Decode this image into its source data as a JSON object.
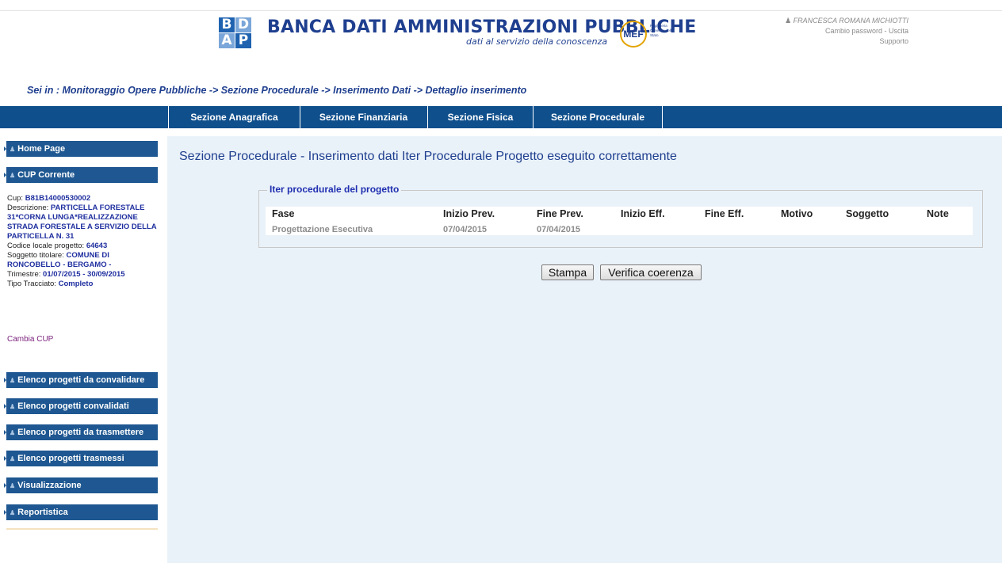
{
  "header": {
    "logo_letters": [
      "B",
      "D",
      "A",
      "P"
    ],
    "title": "BANCA DATI AMMINISTRAZIONI PUBBLICHE",
    "subtitle": "dati al servizio della conoscenza",
    "mef_logo": "MEF",
    "mef_text": "Ragioneria Generale dello Stato",
    "user_icon": "user-icon",
    "user_name": "FRANCESCA ROMANA MICHIOTTI",
    "change_password": "Cambio password",
    "separator": " - ",
    "logout": "Uscita",
    "support": "Supporto"
  },
  "breadcrumb": "Sei in : Monitoraggio Opere Pubbliche -> Sezione Procedurale -> Inserimento Dati -> Dettaglio inserimento",
  "nav": {
    "tabs": [
      "Sezione Anagrafica",
      "Sezione Finanziaria",
      "Sezione Fisica",
      "Sezione Procedurale"
    ]
  },
  "sidebar": {
    "home": "Home Page",
    "cup_corrente": "CUP Corrente",
    "cup": {
      "cup_label": "Cup: ",
      "cup_value": "B81B14000530002",
      "descrizione_label": "Descrizione: ",
      "descrizione_value": "PARTICELLA FORESTALE 31*CORNA LUNGA*REALIZZAZIONE STRADA FORESTALE A SERVIZIO DELLA PARTICELLA N. 31",
      "codice_label": "Codice locale progetto: ",
      "codice_value": "64643",
      "soggetto_label": "Soggetto titolare: ",
      "soggetto_value": "COMUNE DI RONCOBELLO - BERGAMO -",
      "trimestre_label": "Trimestre: ",
      "trimestre_value": "01/07/2015 - 30/09/2015",
      "tipo_label": "Tipo Tracciato: ",
      "tipo_value": "Completo"
    },
    "cambia_cup": "Cambia CUP",
    "items": [
      "Elenco progetti da convalidare",
      "Elenco progetti convalidati",
      "Elenco progetti da trasmettere",
      "Elenco progetti trasmessi",
      "Visualizzazione",
      "Reportistica"
    ]
  },
  "main": {
    "title": "Sezione Procedurale - Inserimento dati Iter Procedurale Progetto eseguito correttamente",
    "fieldset_legend": "Iter procedurale del progetto",
    "columns": [
      "Fase",
      "Inizio Prev.",
      "Fine Prev.",
      "Inizio Eff.",
      "Fine Eff.",
      "Motivo",
      "Soggetto",
      "Note"
    ],
    "rows": [
      [
        "Progettazione Esecutiva",
        "07/04/2015",
        "07/04/2015",
        "",
        "",
        "",
        "",
        ""
      ]
    ],
    "buttons": {
      "print": "Stampa",
      "verify": "Verifica coerenza"
    }
  }
}
